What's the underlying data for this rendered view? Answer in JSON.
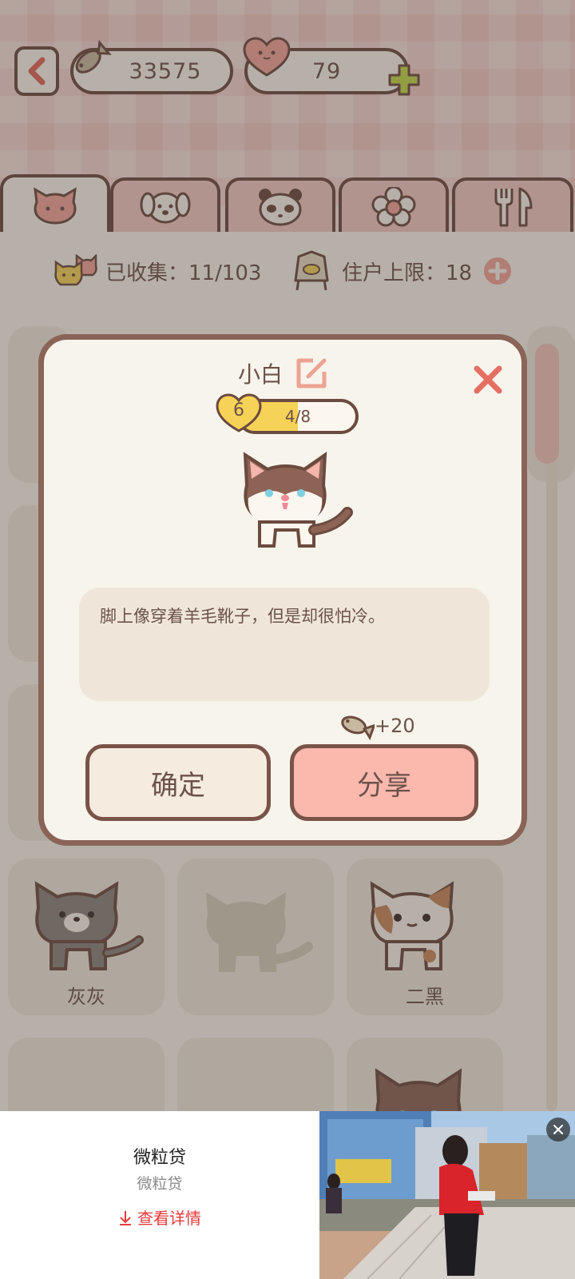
{
  "header": {
    "fish_count": "33575",
    "heart_count": "79"
  },
  "tabs": [
    {
      "icon": "cat-face-icon"
    },
    {
      "icon": "dog-face-icon"
    },
    {
      "icon": "panda-face-icon"
    },
    {
      "icon": "flower-icon"
    },
    {
      "icon": "fork-knife-icon"
    }
  ],
  "stats": {
    "collected_label": "已收集：11/103",
    "resident_label": "住户上限：18"
  },
  "grid": [
    {
      "name": "灰灰",
      "visible": true
    },
    {
      "name": "",
      "visible": false
    },
    {
      "name": "二黑",
      "visible": true
    }
  ],
  "modal": {
    "cat_name": "小白",
    "level": "6",
    "progress_text": "4/8",
    "progress_fraction": 0.5,
    "description": "脚上像穿着羊毛靴子，但是却很怕冷。",
    "reward": "+20",
    "confirm_label": "确定",
    "share_label": "分享"
  },
  "ad": {
    "title": "微粒贷",
    "subtitle": "微粒贷",
    "link_label": "查看详情"
  },
  "colors": {
    "outline": "#6b4a3f",
    "accent_pink": "#fbb8ad",
    "cream": "#f7f4ec",
    "gold": "#f6d257"
  }
}
